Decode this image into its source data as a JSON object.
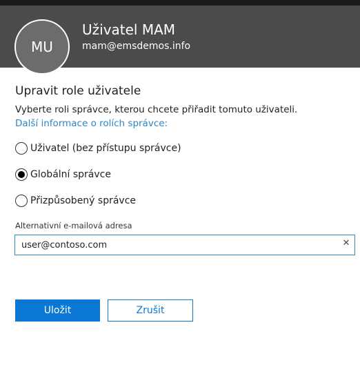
{
  "header": {
    "avatar_initials": "MU",
    "user_name": "Uživatel MAM",
    "user_email": "mam@emsdemos.info"
  },
  "roles_section": {
    "title": "Upravit role uživatele",
    "description": "Vyberte roli správce, kterou chcete přiřadit tomuto uživateli.",
    "more_info_link": "Další informace o rolích správce:",
    "options": [
      {
        "label": "Uživatel (bez přístupu správce)",
        "selected": false
      },
      {
        "label": "Globální správce",
        "selected": true
      },
      {
        "label": "Přizpůsobený správce",
        "selected": false
      }
    ]
  },
  "alt_email": {
    "label": "Alternativní e-mailová adresa",
    "value": "user@contoso.com",
    "clear_icon": "close-icon"
  },
  "actions": {
    "save_label": "Uložit",
    "cancel_label": "Zrušit"
  },
  "colors": {
    "header_bg": "#4b4b4b",
    "accent": "#0a78d4",
    "link": "#2d86c8"
  }
}
